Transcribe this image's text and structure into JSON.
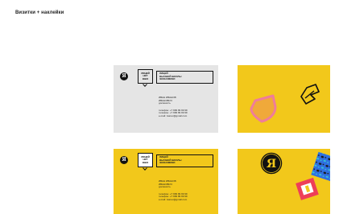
{
  "page": {
    "title": "Визитки + наклейки"
  },
  "colors": {
    "gray_card": "#e5e5e5",
    "yellow": "#f2c81b",
    "ink": "#111111",
    "badge_orange": "#f0a93a",
    "badge_pink": "#ef7d9a",
    "sticker_blue": "#2f6fe0",
    "sticker_red": "#ee3e58"
  },
  "cards": [
    {
      "variant": "gray",
      "stamp": [
        "ЛИЦЕЙ",
        "НЕТ",
        "ВШЭ"
      ],
      "org": [
        "ЛИЦЕЙ",
        "ВЫСШЕЙ ШКОЛЫ",
        "ЭКОНОМИКИ"
      ],
      "name": [
        "ИВАН ИВАНОВ",
        "ИВАНОВИЧ"
      ],
      "position": "должность",
      "contacts": [
        "телефон: +7 999 99 99 99",
        "телефон: +7 999 99 99 99",
        "e-mail: ivanov@gmail.com"
      ]
    },
    {
      "variant": "yellow",
      "stamp": [
        "ЛИЦЕЙ",
        "НЕТ",
        "ВШЭ"
      ],
      "org": [
        "ЛИЦЕЙ",
        "ВЫСШЕЙ ШКОЛЫ",
        "ЭКОНОМИКИ"
      ],
      "name": [
        "ИВАН ИВАНОВ",
        "ИВАНОВИЧ"
      ],
      "position": "должность",
      "contacts": [
        "телефон: +7 999 99 99 99",
        "телефон: +7 999 99 99 99",
        "e-mail: ivanov@gmail.com"
      ]
    }
  ],
  "stickers": {
    "monogram": "Я",
    "card_logo": "Я",
    "icons": [
      "shield-sticker",
      "arrow-sticker",
      "monogram-sticker",
      "leopard-sticker",
      "frame-sticker"
    ]
  }
}
